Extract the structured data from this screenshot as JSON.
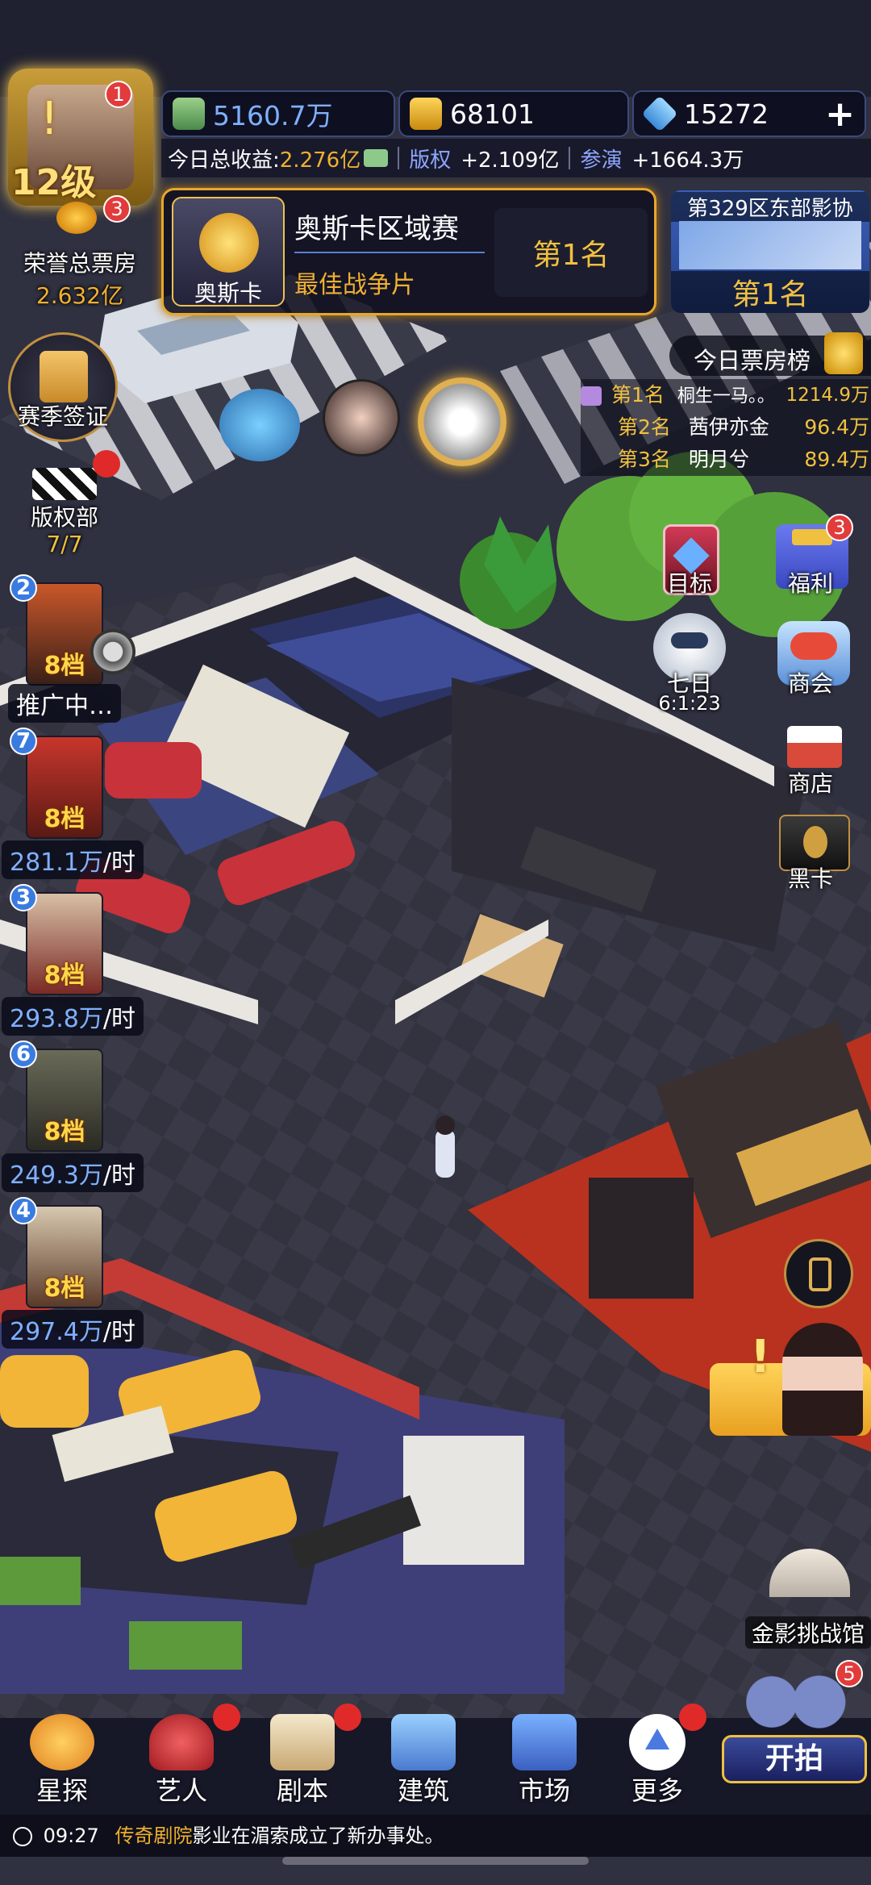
{
  "player": {
    "level": "12级",
    "level_badge": "1",
    "honor_badge": "3",
    "honor_label": "荣誉总票房",
    "honor_value": "2.632亿"
  },
  "resources": {
    "cash": "5160.7万",
    "gold": "68101",
    "diamonds": "15272",
    "add_symbol": "+"
  },
  "income": {
    "today_label": "今日总收益:",
    "today_value": "2.276亿",
    "copyright_label": "版权",
    "copyright_value": "+2.109亿",
    "acting_label": "参演",
    "acting_value": "+1664.3万"
  },
  "oscar": {
    "card_label": "奥斯卡",
    "title": "奥斯卡区域赛",
    "subtitle": "最佳战争片",
    "rank": "第1名"
  },
  "region": {
    "title": "第329区东部影协",
    "rank": "第1名"
  },
  "box_office": {
    "title": "今日票房榜",
    "rows": [
      {
        "rank": "第1名",
        "name": "桐生一马。。",
        "value": "1214.9万"
      },
      {
        "rank": "第2名",
        "name": "茜伊亦金",
        "value": "96.4万"
      },
      {
        "rank": "第3名",
        "name": "明月兮",
        "value": "89.4万"
      }
    ]
  },
  "season": {
    "label": "赛季签证"
  },
  "copyright_dept": {
    "label": "版权部",
    "count": "7/7"
  },
  "right_menu": {
    "goal": "目标",
    "welfare": "福利",
    "welfare_badge": "3",
    "seven_day": "七日",
    "seven_timer": "6:1:23",
    "merchant": "商会",
    "shop": "商店",
    "black_card": "黑卡"
  },
  "films": [
    {
      "rank": "2",
      "grade": "8档",
      "status": "推广中…",
      "rate": "",
      "unit": ""
    },
    {
      "rank": "7",
      "grade": "8档",
      "status": "",
      "rate": "281.1万",
      "unit": "/时"
    },
    {
      "rank": "3",
      "grade": "8档",
      "status": "",
      "rate": "293.8万",
      "unit": "/时"
    },
    {
      "rank": "6",
      "grade": "8档",
      "status": "",
      "rate": "249.3万",
      "unit": "/时"
    },
    {
      "rank": "4",
      "grade": "8档",
      "status": "",
      "rate": "297.4万",
      "unit": "/时"
    }
  ],
  "challenge": {
    "label": "金影挑战馆"
  },
  "nav": {
    "scout": "星探",
    "artist": "艺人",
    "script": "剧本",
    "build": "建筑",
    "market": "市场",
    "more": "更多",
    "shoot": "开拍",
    "shoot_badge": "5"
  },
  "ticker": {
    "time": "09:27",
    "studio": "传奇剧院",
    "message": "影业在湄索成立了新办事处。"
  },
  "colors": {
    "gold": "#f0b030",
    "blue_value": "#7fb0ff",
    "badge_red": "#e23b3b",
    "rank_blue": "#3a7be0"
  }
}
